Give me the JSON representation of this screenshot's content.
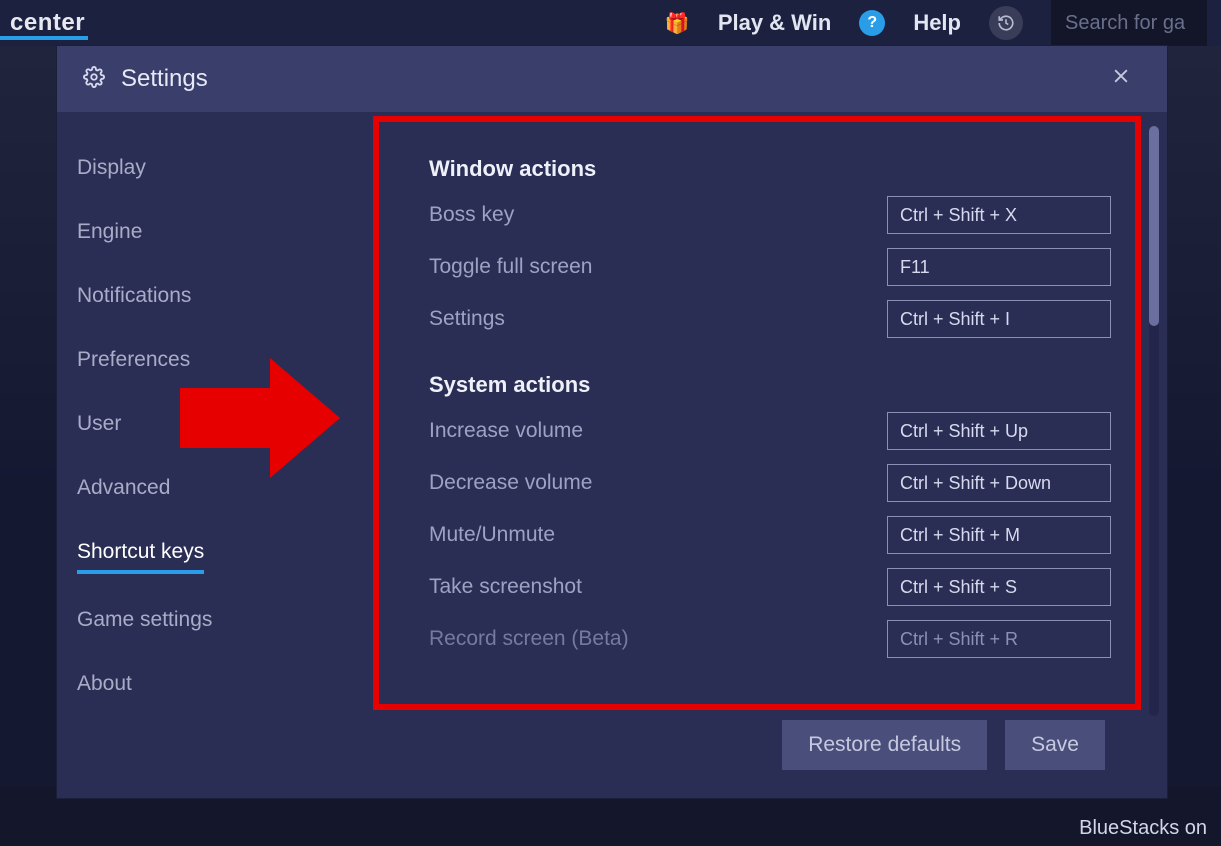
{
  "background": {
    "title_fragment": "center",
    "play_win_label": "Play & Win",
    "help_label": "Help",
    "search_placeholder": "Search for ga",
    "footer_text": "BlueStacks on"
  },
  "modal": {
    "title": "Settings"
  },
  "sidebar": {
    "items": [
      {
        "label": "Display"
      },
      {
        "label": "Engine"
      },
      {
        "label": "Notifications"
      },
      {
        "label": "Preferences"
      },
      {
        "label": "User"
      },
      {
        "label": "Advanced"
      },
      {
        "label": "Shortcut keys",
        "active": true
      },
      {
        "label": "Game settings"
      },
      {
        "label": "About"
      }
    ]
  },
  "content": {
    "sections": [
      {
        "title": "Window actions",
        "rows": [
          {
            "label": "Boss key",
            "value": "Ctrl + Shift + X"
          },
          {
            "label": "Toggle full screen",
            "value": "F11"
          },
          {
            "label": "Settings",
            "value": "Ctrl + Shift + I"
          }
        ]
      },
      {
        "title": "System actions",
        "rows": [
          {
            "label": "Increase volume",
            "value": "Ctrl + Shift + Up"
          },
          {
            "label": "Decrease volume",
            "value": "Ctrl + Shift + Down"
          },
          {
            "label": "Mute/Unmute",
            "value": "Ctrl + Shift + M"
          },
          {
            "label": "Take screenshot",
            "value": "Ctrl + Shift + S"
          },
          {
            "label": "Record screen (Beta)",
            "value": "Ctrl + Shift + R",
            "faded": true
          }
        ]
      }
    ]
  },
  "footer": {
    "restore_label": "Restore defaults",
    "save_label": "Save"
  }
}
